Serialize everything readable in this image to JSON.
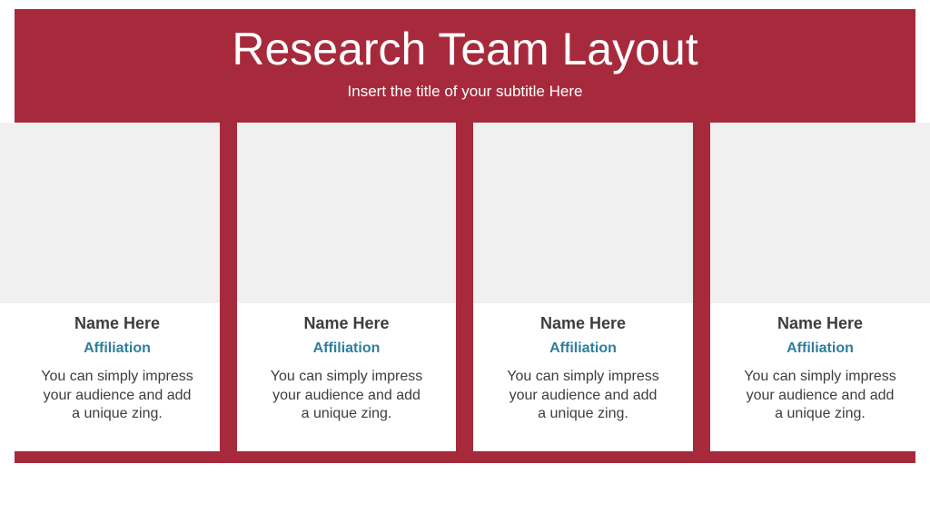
{
  "header": {
    "title": "Research Team Layout",
    "subtitle": "Insert the title of your subtitle Here"
  },
  "colors": {
    "accent": "#a72a3c",
    "affiliation": "#2e7ea0",
    "photo_placeholder": "#f0f0f0",
    "text": "#3d3d3d"
  },
  "members": [
    {
      "name": "Name Here",
      "affiliation": "Affiliation",
      "description": "You can simply impress your audience and add a unique zing."
    },
    {
      "name": "Name Here",
      "affiliation": "Affiliation",
      "description": "You can simply impress your audience and add a unique zing."
    },
    {
      "name": "Name Here",
      "affiliation": "Affiliation",
      "description": "You can simply impress your audience and add a unique zing."
    },
    {
      "name": "Name Here",
      "affiliation": "Affiliation",
      "description": "You can simply impress your audience and add a unique zing."
    }
  ]
}
